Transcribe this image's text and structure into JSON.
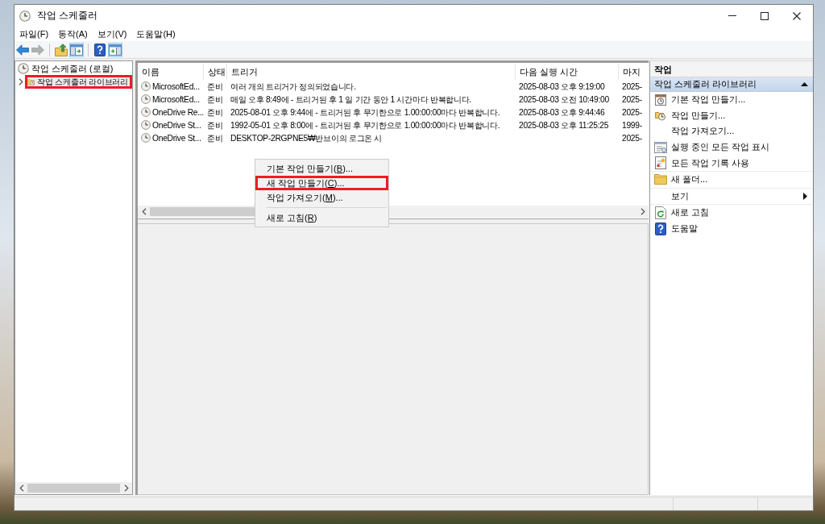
{
  "window": {
    "title": "작업 스케줄러"
  },
  "menu_bar": [
    "파일(F)",
    "동작(A)",
    "보기(V)",
    "도움말(H)"
  ],
  "toolbar_groups": [
    {
      "buttons": [
        {
          "kind": "back",
          "disabled": false,
          "pressed": false
        },
        {
          "kind": "forward",
          "disabled": true,
          "pressed": false
        }
      ]
    },
    {
      "buttons": [
        {
          "kind": "up",
          "disabled": false,
          "pressed": false
        },
        {
          "kind": "tree",
          "disabled": false,
          "pressed": true
        }
      ]
    },
    {
      "buttons": [
        {
          "kind": "help",
          "disabled": false,
          "pressed": false
        },
        {
          "kind": "actions",
          "disabled": false,
          "pressed": true
        }
      ]
    }
  ],
  "tree": [
    {
      "kind": "scheduler",
      "label": "작업 스케줄러 (로컬)",
      "selected": false,
      "highlighted": false,
      "children": [
        {
          "kind": "folder",
          "label": "작업 스케줄러 라이브러리",
          "expanded": false,
          "selected": true,
          "highlighted": true
        }
      ]
    }
  ],
  "table": {
    "columns": [
      "이름",
      "상태",
      "트리거",
      "다음 실행 시간",
      "마지"
    ],
    "rows": [
      {
        "name": "MicrosoftEd...",
        "status": "준비",
        "trigger": "여러 개의 트리거가 정의되었습니다.",
        "next_run_time": "2025-08-03 오후 9:19:00",
        "column_5": "2025-",
        "selected": false
      },
      {
        "name": "MicrosoftEd...",
        "status": "준비",
        "trigger": "매일 오후 8:49에 - 트리거된 후 1 일 기간 동안 1 시간마다 반복합니다.",
        "next_run_time": "2025-08-03 오전 10:49:00",
        "column_5": "2025-",
        "selected": false
      },
      {
        "name": "OneDrive Re...",
        "status": "준비",
        "trigger": "2025-08-01 오후 9:44에 - 트리거된 후 무기한으로 1.00:00:00마다 반복합니다.",
        "next_run_time": "2025-08-03 오후 9:44:46",
        "column_5": "2025-",
        "selected": false
      },
      {
        "name": "OneDrive St...",
        "status": "준비",
        "trigger": "1992-05-01 오후 8:00에 - 트리거된 후 무기한으로 1.00:00:00마다 반복합니다.",
        "next_run_time": "2025-08-03 오후 11:25:25",
        "column_5": "1999-",
        "selected": false
      },
      {
        "name": "OneDrive St...",
        "status": "준비",
        "trigger": "DESKTOP-2RGPNE5₩반브이의 로그온 시",
        "column_5": "2025-",
        "selected": false
      }
    ]
  },
  "context_menu": {
    "groups": [
      {
        "items": [
          {
            "label_start": "기본 작업 만들기(",
            "access_key": "B",
            "label_end": ")...",
            "highlighted": false
          },
          {
            "label_start": "새 작업 만들기(",
            "access_key": "C",
            "label_end": ")...",
            "highlighted": true
          },
          {
            "label_start": "작업 가져오기(",
            "access_key": "M",
            "label_end": ")...",
            "highlighted": false
          }
        ]
      },
      {
        "items": [
          {
            "label_start": "새로 고침(",
            "access_key": "R",
            "label_end": ")",
            "highlighted": false
          }
        ]
      }
    ]
  },
  "actions_pane": {
    "title": "작업",
    "sections": [
      {
        "title": "작업 스케줄러 라이브러리",
        "expanded": true,
        "groups": [
          {
            "items": [
              {
                "kind": "basic",
                "label": "기본 작업 만들기...",
                "has_submenu": false
              },
              {
                "kind": "create",
                "label": "작업 만들기...",
                "has_submenu": false
              },
              {
                "kind": "import",
                "label": "작업 가져오기...",
                "has_submenu": false
              },
              {
                "kind": "running",
                "label": "실행 중인 모든 작업 표시",
                "has_submenu": false
              },
              {
                "kind": "history",
                "label": "모든 작업 기록 사용",
                "has_submenu": false
              }
            ]
          },
          {
            "items": [
              {
                "kind": "folder",
                "label": "새 폴더...",
                "has_submenu": false
              }
            ]
          },
          {
            "items": [
              {
                "kind": "view",
                "label": "보기",
                "has_submenu": true
              }
            ]
          },
          {
            "items": [
              {
                "kind": "refresh",
                "label": "새로 고침",
                "has_submenu": false
              },
              {
                "kind": "help",
                "label": "도움말",
                "has_submenu": false
              }
            ]
          }
        ]
      }
    ]
  }
}
